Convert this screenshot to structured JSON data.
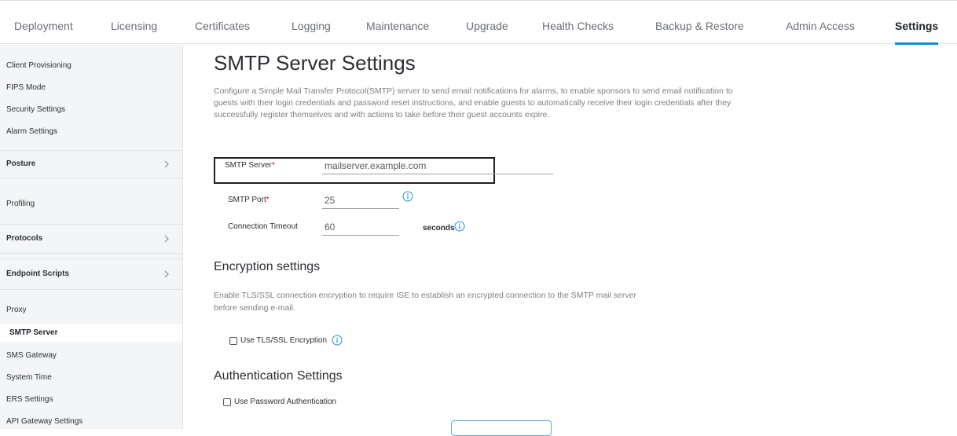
{
  "top_tabs": [
    {
      "label": "Deployment"
    },
    {
      "label": "Licensing"
    },
    {
      "label": "Certificates"
    },
    {
      "label": "Logging"
    },
    {
      "label": "Maintenance"
    },
    {
      "label": "Upgrade"
    },
    {
      "label": "Health Checks"
    },
    {
      "label": "Backup & Restore"
    },
    {
      "label": "Admin Access"
    },
    {
      "label": "Settings"
    }
  ],
  "sidebar": {
    "items": [
      {
        "label": "Client Provisioning"
      },
      {
        "label": "FIPS Mode"
      },
      {
        "label": "Security Settings"
      },
      {
        "label": "Alarm Settings"
      },
      {
        "label": "Posture"
      },
      {
        "label": "Profiling"
      },
      {
        "label": "Protocols"
      },
      {
        "label": "Endpoint Scripts"
      },
      {
        "label": "Proxy"
      },
      {
        "label": "SMTP Server"
      },
      {
        "label": "SMS Gateway"
      },
      {
        "label": "System Time"
      },
      {
        "label": "ERS Settings"
      },
      {
        "label": "API Gateway Settings"
      }
    ]
  },
  "main": {
    "title": "SMTP Server Settings",
    "description": "Configure a Simple Mail Transfer Protocol(SMTP) server to send email notifications for alarms, to enable sponsors to send email notification to guests with their login credentials and password reset instructions, and enable guests to automatically receive their login credentials after they successfully register themselves and with actions to take before their guest accounts expire.",
    "smtp_server": {
      "label": "SMTP Server",
      "required_mark": "*",
      "value": "mailserver.example.com"
    },
    "smtp_port": {
      "label": "SMTP Port",
      "required_mark": "*",
      "value": "25"
    },
    "connection_timeout": {
      "label": "Connection Timeout",
      "value": "60",
      "unit": "seconds"
    },
    "encryption": {
      "heading": "Encryption settings",
      "description": "Enable TLS/SSL connection encryption to require ISE to establish an encrypted connection to the SMTP mail server before sending e-mail.",
      "checkbox_label": "Use TLS/SSL Encryption"
    },
    "authentication": {
      "heading": "Authentication Settings",
      "checkbox_label": "Use Password Authentication"
    }
  },
  "colors": {
    "accent": "#0d8fd0",
    "info_icon": "#1e90d6",
    "required": "#d0021b"
  },
  "icons": {
    "chevron": "chevron-right-icon",
    "info": "info-icon"
  }
}
